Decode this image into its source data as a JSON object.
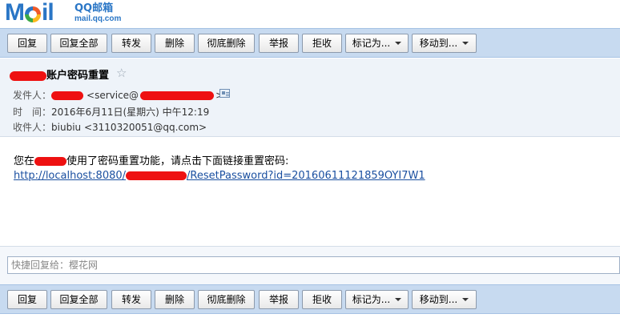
{
  "logo": {
    "brand": "Mail",
    "cn": "QQ邮箱",
    "en": "mail.qq.com"
  },
  "toolbar": {
    "reply": "回复",
    "reply_all": "回复全部",
    "forward": "转发",
    "delete": "删除",
    "delete_permanently": "彻底删除",
    "report": "举报",
    "reject": "拒收",
    "mark_as": "标记为...",
    "move_to": "移动到..."
  },
  "mail": {
    "subject": "账户密码重置",
    "from_label": "发件人：",
    "from_address": "<service@",
    "from_address_end": ">",
    "time_label": "时　间：",
    "time_value": "2016年6月11日(星期六) 中午12:19",
    "to_label": "收件人：",
    "to_name": "biubiu",
    "to_address": "<3110320051@qq.com>",
    "body_pre": "您在",
    "body_post": "使用了密码重置功能，请点击下面链接重置密码:",
    "link_pre": "http://localhost:8080/",
    "link_post": "/ResetPassword?id=20160611121859OYI7W1"
  },
  "quick_reply": {
    "placeholder": "快捷回复给：樱花网"
  },
  "icons": {
    "star": "star-icon",
    "contact_card": "contact-card-icon",
    "dropdown": "chevron-down-icon"
  },
  "colors": {
    "toolbar_bg": "#c7daf0",
    "meta_bg": "#eef3f9",
    "link": "#1a4fa0",
    "redaction": "#ee1111"
  }
}
